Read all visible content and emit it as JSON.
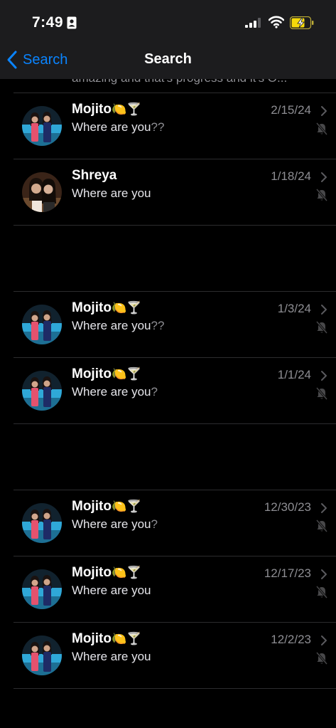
{
  "status_bar": {
    "time": "7:49",
    "icons": [
      "id-badge-icon",
      "signal-icon",
      "wifi-icon",
      "battery-charging-icon"
    ]
  },
  "nav": {
    "back_label": "Search",
    "title": "Search"
  },
  "partial_row": {
    "text": "amazing and that's progress and it's O..."
  },
  "rows": [
    {
      "kind": "message",
      "name": "Mojito",
      "emojis": "🍋🍸",
      "preview": "Where are you",
      "preview_extra": "??",
      "date": "2/15/24"
    },
    {
      "kind": "message",
      "name": "Shreya",
      "emojis": "",
      "preview": "Where are you",
      "preview_extra": "",
      "date": "1/18/24"
    },
    {
      "kind": "blank"
    },
    {
      "kind": "message",
      "name": "Mojito",
      "emojis": "🍋🍸",
      "preview": "Where are you",
      "preview_extra": "??",
      "date": "1/3/24"
    },
    {
      "kind": "message",
      "name": "Mojito",
      "emojis": "🍋🍸",
      "preview": "Where are you",
      "preview_extra": "?",
      "date": "1/1/24"
    },
    {
      "kind": "blank"
    },
    {
      "kind": "message",
      "name": "Mojito",
      "emojis": "🍋🍸",
      "preview": "Where are you",
      "preview_extra": "?",
      "date": "12/30/23"
    },
    {
      "kind": "message",
      "name": "Mojito",
      "emojis": "🍋🍸",
      "preview": "Where are you",
      "preview_extra": "",
      "date": "12/17/23"
    },
    {
      "kind": "message",
      "name": "Mojito",
      "emojis": "🍋🍸",
      "preview": "Where are you",
      "preview_extra": "",
      "date": "12/2/23"
    }
  ],
  "colors": {
    "accent": "#0a84ff",
    "background": "#000000",
    "header": "#1c1c1e",
    "secondary_text": "#8e8e93",
    "divider": "#2c2c2e"
  }
}
